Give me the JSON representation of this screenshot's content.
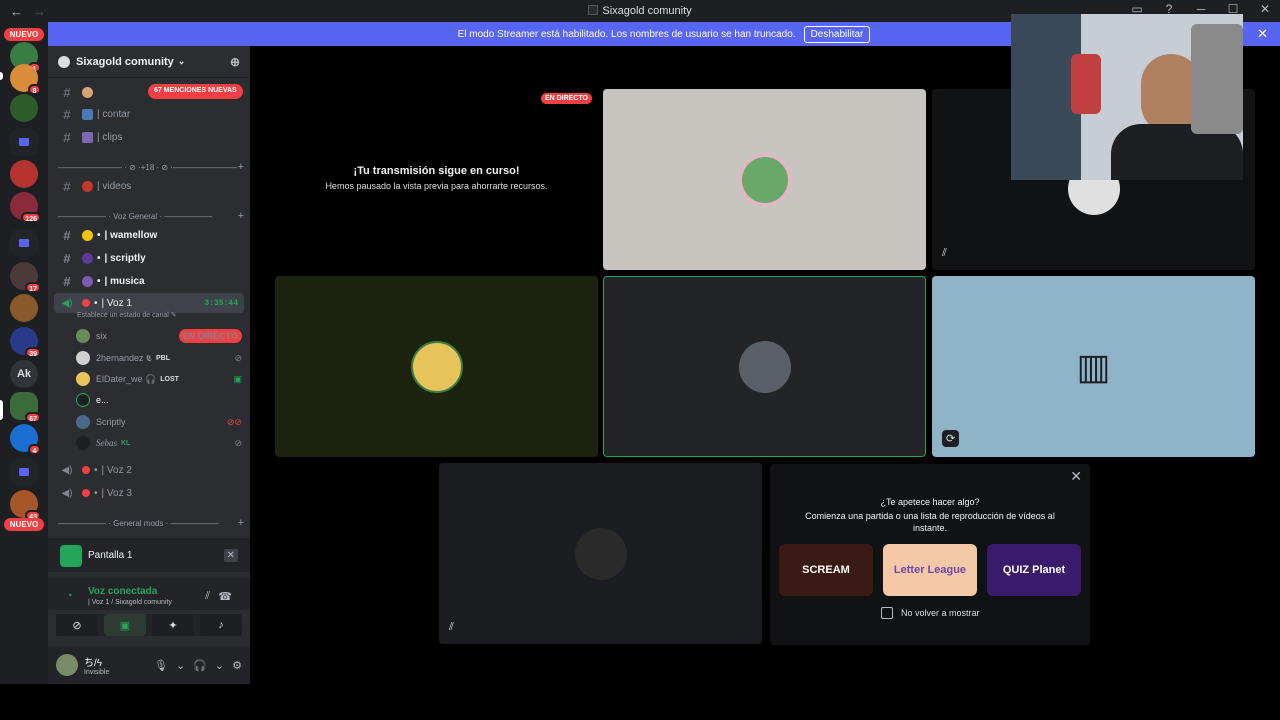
{
  "window": {
    "title": "Sixagold comunity",
    "back": "←",
    "forward": "→",
    "controls": [
      "▭",
      "?",
      "─",
      "☐",
      "✕"
    ]
  },
  "banner": {
    "text": "El modo Streamer está habilitado. Los nombres de usuario se han truncado.",
    "button": "Deshabilitar"
  },
  "rail": {
    "new_top": "NUEVO",
    "new_bottom": "NUEVO",
    "ak_label": "Ak",
    "badges": [
      "1",
      "8",
      "126",
      "17",
      "39",
      "67",
      "4",
      "43"
    ]
  },
  "server": {
    "name": "Sixagold comunity",
    "mentions": "67 MENCIONES NUEVAS"
  },
  "channels": [
    {
      "name": "| contar"
    },
    {
      "name": "| clips"
    },
    {
      "name": "| videos"
    },
    {
      "name": "| wamellow"
    },
    {
      "name": "| scriptly"
    },
    {
      "name": "| musica"
    }
  ],
  "categories": {
    "cat1": "———————— · ⊘ ·+18 · ⊘ ·————————",
    "cat2": "—————— · Voz General · ——————",
    "cat3": "—————— · General mods · ——————"
  },
  "voice": {
    "active": {
      "name": "| Voz 1",
      "timer": "3:35:44",
      "status": "Establece un estado de canal"
    },
    "users": [
      {
        "name": "six",
        "tag": "",
        "live": "EN DIRECTO"
      },
      {
        "name": "2hernandez 𝕮",
        "tag": "PBL"
      },
      {
        "name": "ElDater_we 🎧",
        "tag": "LOST"
      },
      {
        "name": "e...",
        "tag": ""
      },
      {
        "name": "Scriptly",
        "tag": ""
      },
      {
        "name": "Sebas",
        "tag": "KL"
      }
    ],
    "others": [
      "| Voz 2",
      "| Voz 3"
    ]
  },
  "panel": {
    "screen": "Pantalla 1",
    "connected": "Voz conectada",
    "connected_sub": "| Voz 1 / Sixagold comunity",
    "user": "ち/ϟ",
    "user_status": "Invisible"
  },
  "stage": {
    "paused_title": "¡Tu transmisión sigue en curso!",
    "paused_sub": "Hemos pausado la vista previa para ahorrarte recursos.",
    "live": "EN DIRECTO"
  },
  "activity": {
    "question": "¿Te apetece hacer algo?",
    "desc": "Comienza una partida o una lista de reproducción de vídeos al instante.",
    "games": [
      "SCREAM",
      "Letter League",
      "QUIZ Planet"
    ],
    "dont_show": "No volver a mostrar"
  },
  "colors": {
    "accent": "#5865f2",
    "live": "#f23f43",
    "online": "#23a55a"
  }
}
